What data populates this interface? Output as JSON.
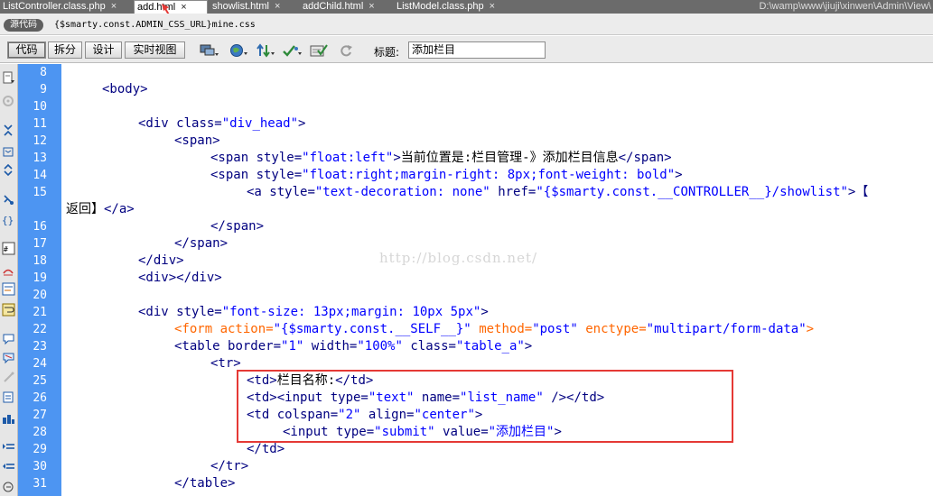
{
  "tabs": [
    {
      "label": "ListController.class.php",
      "active": false
    },
    {
      "label": "add.html",
      "active": true
    },
    {
      "label": "showlist.html",
      "active": false
    },
    {
      "label": "addChild.html",
      "active": false
    },
    {
      "label": "ListModel.class.php",
      "active": false
    }
  ],
  "close_glyph": "×",
  "file_path": "D:\\wamp\\www\\jiuji\\xinwen\\Admin\\View\\",
  "related": {
    "source_label": "源代码",
    "file": "{$smarty.const.ADMIN_CSS_URL}mine.css"
  },
  "toolbar": {
    "views": [
      "代码",
      "拆分",
      "设计",
      "实时视图"
    ],
    "active_view": "代码",
    "title_label": "标题:",
    "title_value": "添加栏目"
  },
  "icons": {
    "toolbar": [
      "multiscreen-icon",
      "preview-in-browser-icon",
      "file-management-icon",
      "w3c-validation-icon",
      "check-browser-compat-icon",
      "refresh-icon"
    ],
    "side": [
      "open-documents-icon",
      "show-code-navigator-icon",
      "collapse-full-tag-icon",
      "collapse-selection-icon",
      "expand-all-icon",
      "select-parent-tag-icon",
      "balance-braces-icon",
      "line-numbers-icon",
      "highlight-invalid-code-icon",
      "syntax-coloring-icon",
      "word-wrap-icon",
      "apply-comment-icon",
      "remove-comment-icon",
      "wrap-tag-icon",
      "recent-snippets-icon",
      "move-css-icon",
      "indent-code-icon",
      "outdent-code-icon",
      "format-source-icon"
    ]
  },
  "line_numbers": [
    "8",
    "9",
    "10",
    "11",
    "12",
    "13",
    "14",
    "15",
    "",
    "16",
    "17",
    "18",
    "19",
    "20",
    "21",
    "22",
    "23",
    "24",
    "25",
    "26",
    "27",
    "28",
    "29",
    "30",
    "31"
  ],
  "code": [
    {
      "line": 0,
      "indent": 0,
      "text": ""
    },
    {
      "line": 1,
      "indent": 40,
      "text": "<body>"
    },
    {
      "line": 2,
      "indent": 0,
      "text": ""
    },
    {
      "line": 3,
      "indent": 80,
      "text": "<div class=\"div_head\">"
    },
    {
      "line": 4,
      "indent": 120,
      "text": "<span>"
    },
    {
      "line": 5,
      "indent": 160,
      "text": "<span style=\"float:left\">当前位置是:栏目管理-》添加栏目信息</span>"
    },
    {
      "line": 6,
      "indent": 160,
      "text": "<span style=\"float:right;margin-right: 8px;font-weight: bold\">"
    },
    {
      "line": 7,
      "indent": 200,
      "text": "<a style=\"text-decoration: none\" href=\"{$smarty.const.__CONTROLLER__}/showlist\">【"
    },
    {
      "line": 8,
      "indent": 0,
      "text": "返回】</a>"
    },
    {
      "line": 9,
      "indent": 160,
      "text": "</span>"
    },
    {
      "line": 10,
      "indent": 120,
      "text": "</span>"
    },
    {
      "line": 11,
      "indent": 80,
      "text": "</div>"
    },
    {
      "line": 12,
      "indent": 80,
      "text": "<div></div>"
    },
    {
      "line": 13,
      "indent": 0,
      "text": ""
    },
    {
      "line": 14,
      "indent": 80,
      "text": "<div style=\"font-size: 13px;margin: 10px 5px\">"
    },
    {
      "line": 15,
      "indent": 120,
      "text": "<form action=\"{$smarty.const.__SELF__}\" method=\"post\" enctype=\"multipart/form-data\">"
    },
    {
      "line": 16,
      "indent": 120,
      "text": "<table border=\"1\" width=\"100%\" class=\"table_a\">"
    },
    {
      "line": 17,
      "indent": 160,
      "text": "<tr>"
    },
    {
      "line": 18,
      "indent": 200,
      "text": "<td>栏目名称:</td>"
    },
    {
      "line": 19,
      "indent": 200,
      "text": "<td><input type=\"text\" name=\"list_name\" /></td>"
    },
    {
      "line": 20,
      "indent": 200,
      "text": "<td colspan=\"2\" align=\"center\">"
    },
    {
      "line": 21,
      "indent": 240,
      "text": "<input type=\"submit\" value=\"添加栏目\">"
    },
    {
      "line": 22,
      "indent": 200,
      "text": "</td>"
    },
    {
      "line": 23,
      "indent": 160,
      "text": "</tr>"
    },
    {
      "line": 24,
      "indent": 120,
      "text": "</table>"
    }
  ],
  "watermark": "http://blog.csdn.net/"
}
